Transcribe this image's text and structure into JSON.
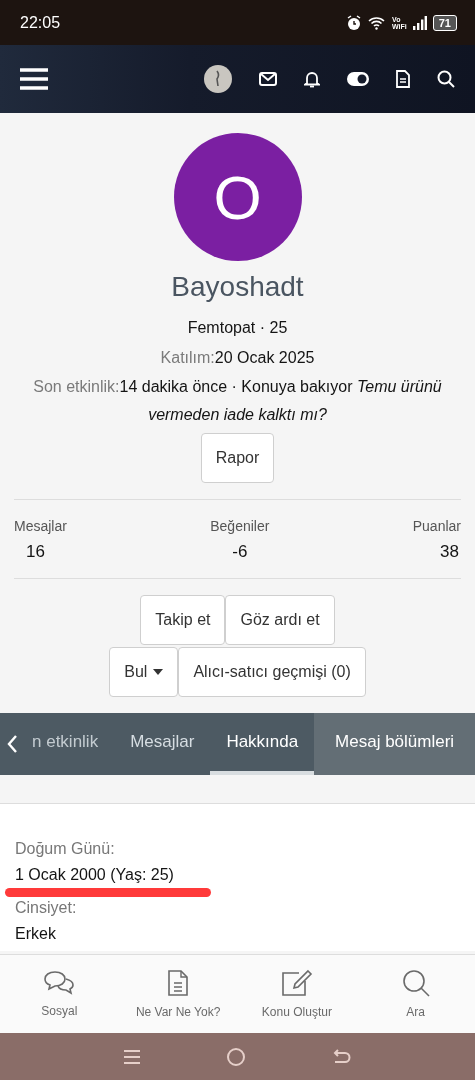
{
  "status_bar": {
    "time": "22:05",
    "network_top": "Vo",
    "network_bottom": "WiFi",
    "battery": "71"
  },
  "profile": {
    "avatar_letter": "O",
    "username": "Bayoshadt",
    "title_line": "Femtopat · 25",
    "joined": {
      "label": "Katılım:",
      "value": "20 Ocak 2025"
    },
    "last_activity": {
      "label": "Son etkinlik:",
      "text": "14 dakika önce · Konuya bakıyor *Temu ürünü vermeden iade kalktı mı?*"
    },
    "report_button": "Rapor"
  },
  "stats": [
    {
      "label": "Mesajlar",
      "value": "16"
    },
    {
      "label": "Beğeniler",
      "value": "-6"
    },
    {
      "label": "Puanlar",
      "value": "38"
    }
  ],
  "follow_buttons": [
    "Takip et",
    "Göz ardı et"
  ],
  "find_button": "Bul",
  "history_button": "Alıcı-satıcı geçmişi (0)",
  "tabs": [
    {
      "label": "n etkinlik",
      "selected": false
    },
    {
      "label": "Mesajlar",
      "selected": false
    },
    {
      "label": "Hakkında",
      "selected": true
    },
    {
      "label": "Mesaj bölümleri",
      "selected": false
    }
  ],
  "about": [
    {
      "label": "Doğum Günü:",
      "value": "1 Ocak 2000 (Yaş: 25)"
    },
    {
      "label": "Cinsiyet:",
      "value": "Erkek"
    }
  ],
  "bottom_nav": [
    "Sosyal",
    "Ne Var Ne Yok?",
    "Konu Oluştur",
    "Ara"
  ]
}
